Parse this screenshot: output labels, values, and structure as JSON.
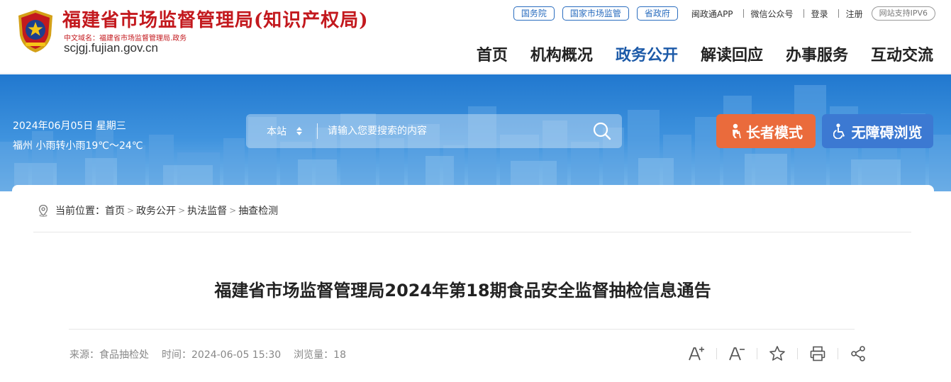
{
  "header": {
    "site_title": "福建省市场监督管理局(知识产权局)",
    "cn_domain": "中文域名：福建省市场监督管理局.政务",
    "en_domain": "scjgj.fujian.gov.cn",
    "brand_color": "#c3191e"
  },
  "toplinks": {
    "pills": [
      "国务院",
      "国家市场监管",
      "省政府"
    ],
    "app": "闽政通APP",
    "wechat": "微信公众号",
    "login": "登录",
    "register": "注册",
    "ipv6": "网站支持IPV6"
  },
  "nav": {
    "items": [
      "首页",
      "机构概况",
      "政务公开",
      "解读回应",
      "办事服务",
      "互动交流"
    ],
    "active": "政务公开",
    "active_color": "#1c5aa8"
  },
  "banner": {
    "date": "2024年06月05日 星期三",
    "weather": "福州 小雨转小雨19℃～24℃",
    "search": {
      "scope": "本站",
      "placeholder": "请输入您要搜索的内容",
      "icon": "search-icon"
    },
    "elder_mode": "长者模式",
    "accessible": "无障碍浏览",
    "elder_color": "#ea6b3c",
    "accessible_color": "#3c79d2"
  },
  "breadcrumb": {
    "prefix": "当前位置：",
    "items": [
      "首页",
      "政务公开",
      "执法监督",
      "抽查检测"
    ],
    "separator": ">"
  },
  "article": {
    "title": "福建省市场监督管理局2024年第18期食品安全监督抽检信息通告",
    "source": "来源：食品抽检处",
    "time": "时间：2024-06-05 15:30",
    "views": "浏览量：18",
    "tools": [
      "font-increase-icon",
      "font-decrease-icon",
      "star-icon",
      "print-icon",
      "share-icon"
    ]
  }
}
